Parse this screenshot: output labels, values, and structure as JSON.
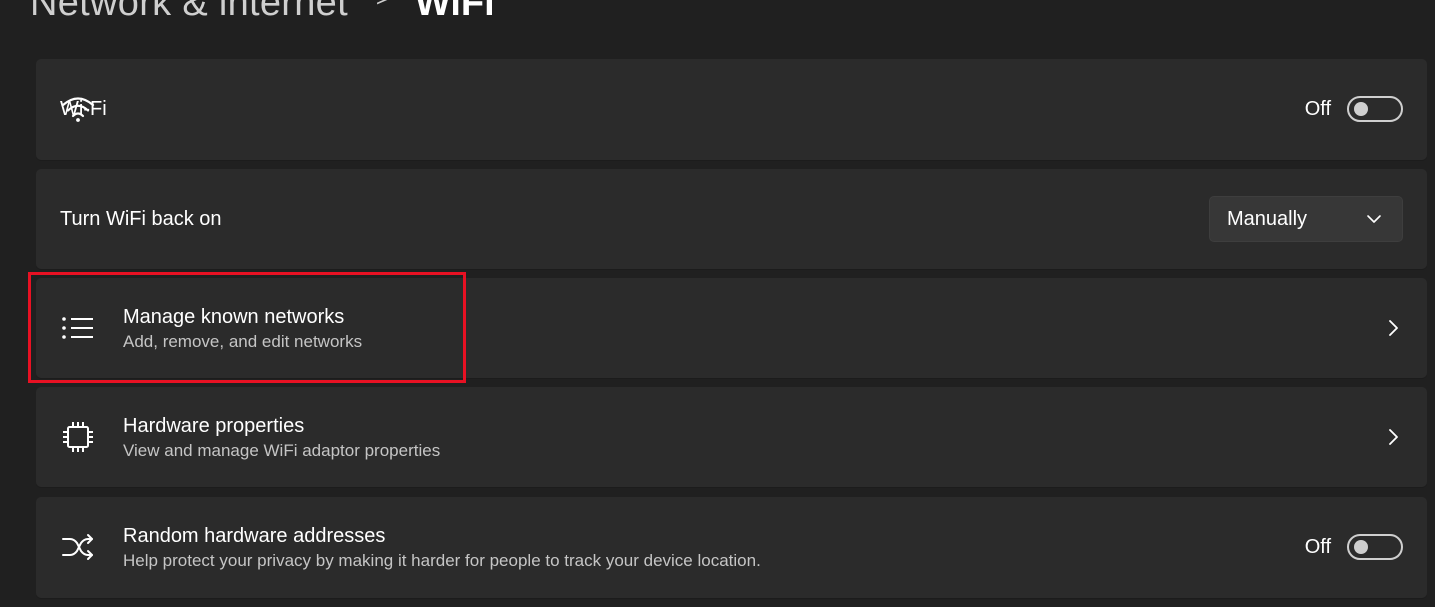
{
  "breadcrumb": {
    "parent": "Network & internet",
    "separator": ">",
    "current": "WiFi"
  },
  "wifi_row": {
    "title": "Wi-Fi",
    "icon": "wifi-icon",
    "toggle_state": "Off"
  },
  "turn_back_on": {
    "title": "Turn WiFi back on",
    "dropdown_value": "Manually",
    "icon": "chevron-down-icon"
  },
  "manage_networks": {
    "title": "Manage known networks",
    "subtitle": "Add, remove, and edit networks",
    "icon": "list-icon"
  },
  "hardware_properties": {
    "title": "Hardware properties",
    "subtitle": "View and manage WiFi adaptor properties",
    "icon": "chip-icon"
  },
  "random_hw": {
    "title": "Random hardware addresses",
    "subtitle": "Help protect your privacy by making it harder for people to track your device location.",
    "toggle_state": "Off",
    "icon": "shuffle-icon"
  },
  "colors": {
    "background": "#202020",
    "card": "#2b2b2b",
    "highlight": "#e81123"
  }
}
